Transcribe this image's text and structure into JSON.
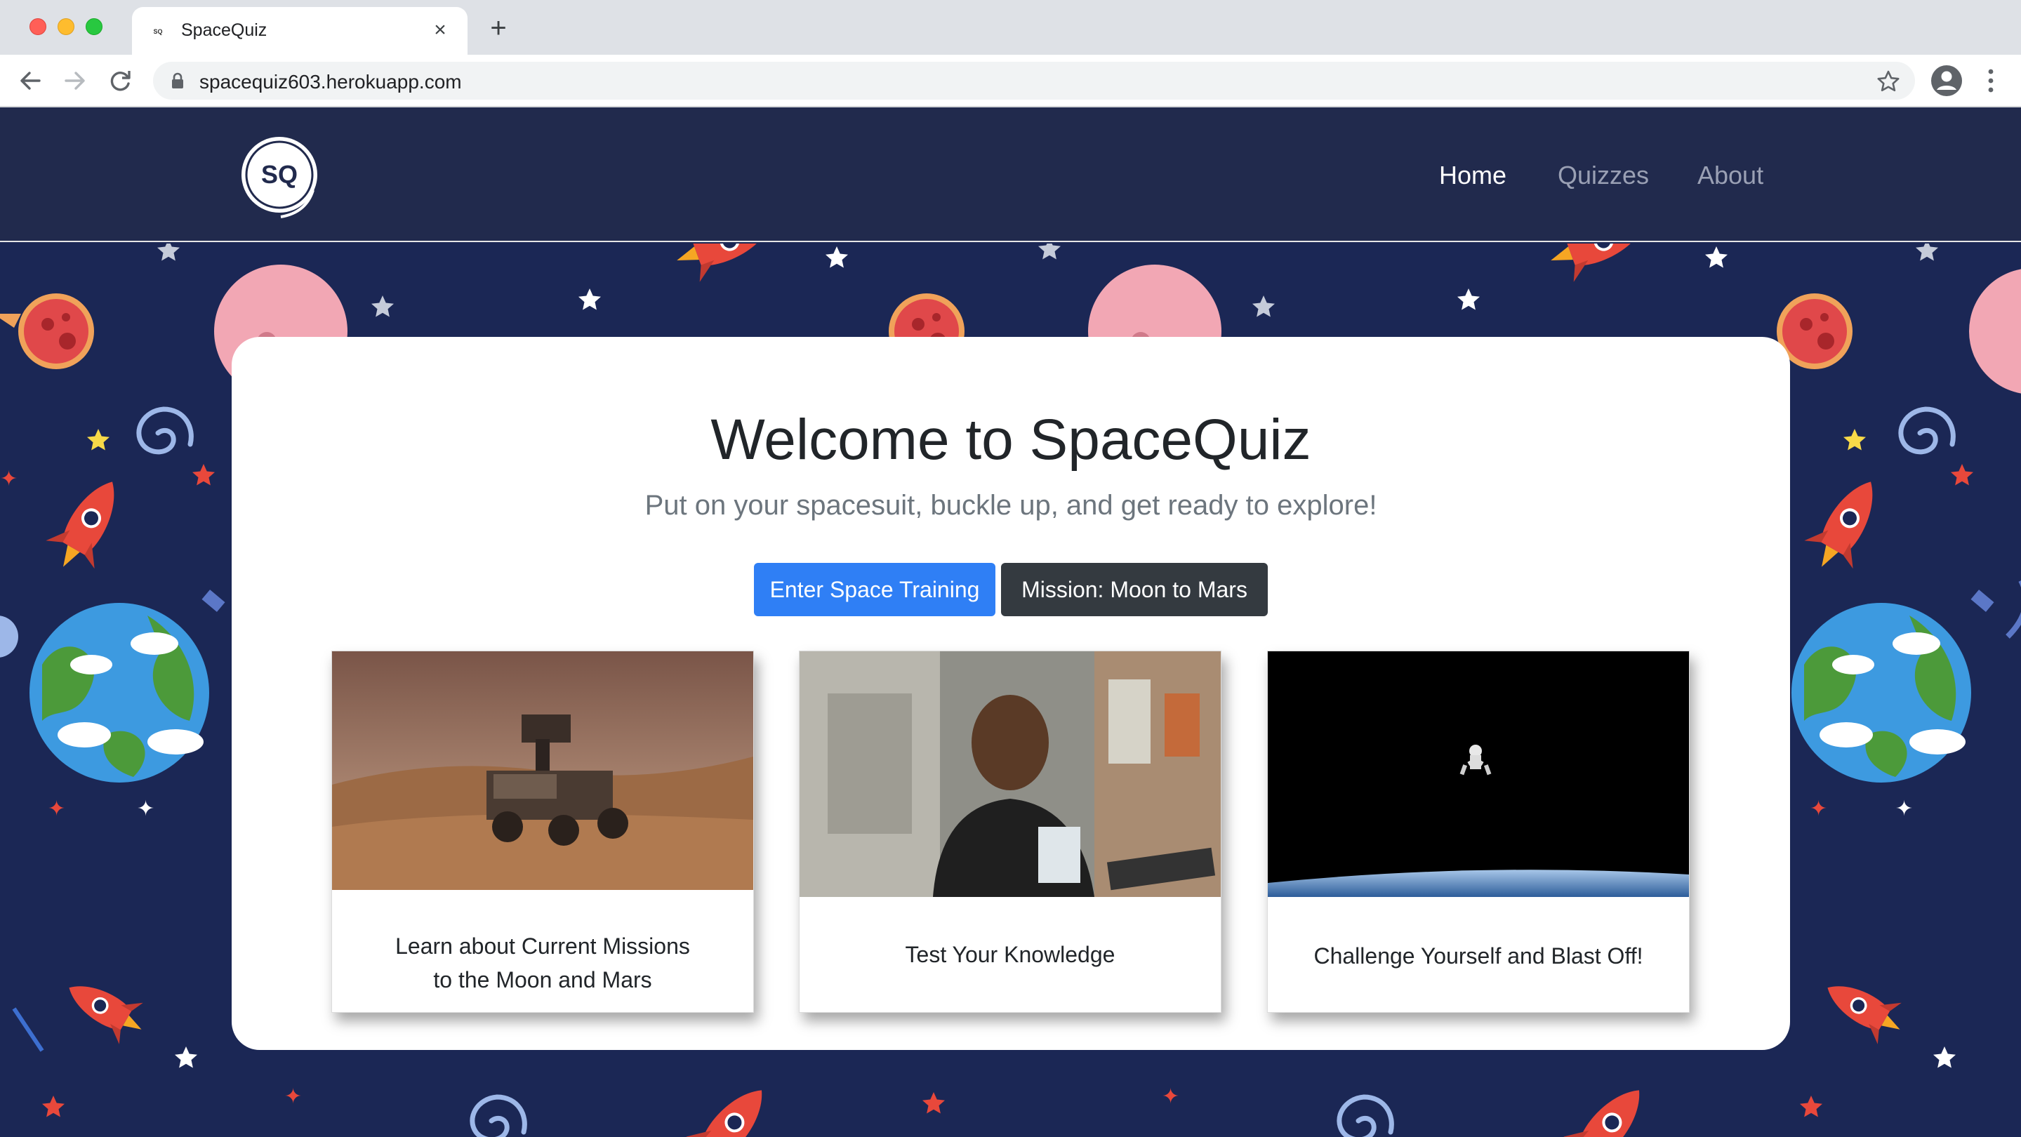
{
  "browser": {
    "tab_title": "SpaceQuiz",
    "favicon_text": "SQ",
    "url": "spacequiz603.herokuapp.com"
  },
  "navbar": {
    "logo_text": "SQ",
    "links": [
      "Home",
      "Quizzes",
      "About"
    ],
    "active_link": "Home"
  },
  "hero": {
    "title": "Welcome to SpaceQuiz",
    "subtitle": "Put on your spacesuit, buckle up, and get ready to explore!",
    "primary_button": "Enter Space Training",
    "secondary_button": "Mission: Moon to Mars"
  },
  "cards": [
    {
      "line1": "Learn about Current Missions",
      "line2": "to the Moon and Mars",
      "image": "mars-rover-photo"
    },
    {
      "line1": "Test Your Knowledge",
      "line2": "",
      "image": "astronaut-in-station-photo"
    },
    {
      "line1": "Challenge Yourself and Blast Off!",
      "line2": "",
      "image": "spacewalk-over-earth-photo"
    }
  ],
  "colors": {
    "navbar": "#212a4d",
    "background": "#1b2755",
    "primary": "#2f7ff5",
    "dark": "#343a40"
  }
}
